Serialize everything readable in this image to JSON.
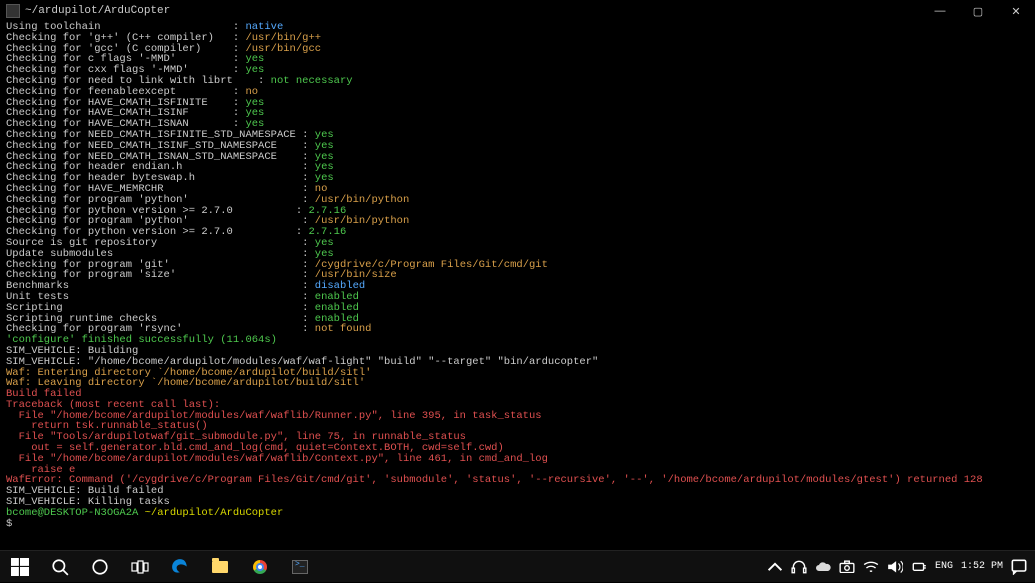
{
  "window": {
    "title": "~/ardupilot/ArduCopter",
    "minimize": "—",
    "maximize": "▢",
    "close": "✕"
  },
  "lines": [
    [
      [
        "w",
        "Using toolchain                     : "
      ],
      [
        "c",
        "native"
      ]
    ],
    [
      [
        "w",
        "Checking for 'g++' (C++ compiler)   : "
      ],
      [
        "g",
        "/usr/bin/g++"
      ]
    ],
    [
      [
        "w",
        "Checking for 'gcc' (C compiler)     : "
      ],
      [
        "g",
        "/usr/bin/gcc"
      ]
    ],
    [
      [
        "w",
        "Checking for c flags '-MMD'         : "
      ],
      [
        "gr",
        "yes"
      ]
    ],
    [
      [
        "w",
        "Checking for cxx flags '-MMD'       : "
      ],
      [
        "gr",
        "yes"
      ]
    ],
    [
      [
        "w",
        "Checking for need to link with librt    : "
      ],
      [
        "gr",
        "not necessary"
      ]
    ],
    [
      [
        "w",
        "Checking for feenableexcept         : "
      ],
      [
        "g",
        "no"
      ]
    ],
    [
      [
        "w",
        "Checking for HAVE_CMATH_ISFINITE    : "
      ],
      [
        "gr",
        "yes"
      ]
    ],
    [
      [
        "w",
        "Checking for HAVE_CMATH_ISINF       : "
      ],
      [
        "gr",
        "yes"
      ]
    ],
    [
      [
        "w",
        "Checking for HAVE_CMATH_ISNAN       : "
      ],
      [
        "gr",
        "yes"
      ]
    ],
    [
      [
        "w",
        "Checking for NEED_CMATH_ISFINITE_STD_NAMESPACE : "
      ],
      [
        "gr",
        "yes"
      ]
    ],
    [
      [
        "w",
        "Checking for NEED_CMATH_ISINF_STD_NAMESPACE    : "
      ],
      [
        "gr",
        "yes"
      ]
    ],
    [
      [
        "w",
        "Checking for NEED_CMATH_ISNAN_STD_NAMESPACE    : "
      ],
      [
        "gr",
        "yes"
      ]
    ],
    [
      [
        "w",
        "Checking for header endian.h                   : "
      ],
      [
        "gr",
        "yes"
      ]
    ],
    [
      [
        "w",
        "Checking for header byteswap.h                 : "
      ],
      [
        "gr",
        "yes"
      ]
    ],
    [
      [
        "w",
        "Checking for HAVE_MEMRCHR                      : "
      ],
      [
        "g",
        "no"
      ]
    ],
    [
      [
        "w",
        "Checking for program 'python'                  : "
      ],
      [
        "g",
        "/usr/bin/python"
      ]
    ],
    [
      [
        "w",
        "Checking for python version >= 2.7.0          : "
      ],
      [
        "gr",
        "2.7.16"
      ]
    ],
    [
      [
        "w",
        "Checking for program 'python'                  : "
      ],
      [
        "g",
        "/usr/bin/python"
      ]
    ],
    [
      [
        "w",
        "Checking for python version >= 2.7.0          : "
      ],
      [
        "gr",
        "2.7.16"
      ]
    ],
    [
      [
        "w",
        "Source is git repository                       : "
      ],
      [
        "gr",
        "yes"
      ]
    ],
    [
      [
        "w",
        "Update submodules                              : "
      ],
      [
        "gr",
        "yes"
      ]
    ],
    [
      [
        "w",
        "Checking for program 'git'                     : "
      ],
      [
        "g",
        "/cygdrive/c/Program Files/Git/cmd/git"
      ]
    ],
    [
      [
        "w",
        "Checking for program 'size'                    : "
      ],
      [
        "g",
        "/usr/bin/size"
      ]
    ],
    [
      [
        "w",
        "Benchmarks                                     : "
      ],
      [
        "c",
        "disabled"
      ]
    ],
    [
      [
        "w",
        "Unit tests                                     : "
      ],
      [
        "gr",
        "enabled"
      ]
    ],
    [
      [
        "w",
        "Scripting                                      : "
      ],
      [
        "gr",
        "enabled"
      ]
    ],
    [
      [
        "w",
        "Scripting runtime checks                       : "
      ],
      [
        "gr",
        "enabled"
      ]
    ],
    [
      [
        "w",
        "Checking for program 'rsync'                   : "
      ],
      [
        "g",
        "not found"
      ]
    ],
    [
      [
        "gr",
        "'configure' finished successfully (11.064s)"
      ]
    ],
    [
      [
        "w",
        "SIM_VEHICLE: Building"
      ]
    ],
    [
      [
        "w",
        "SIM_VEHICLE: \"/home/bcome/ardupilot/modules/waf/waf-light\" \"build\" \"--target\" \"bin/arducopter\""
      ]
    ],
    [
      [
        "g",
        "Waf: Entering directory `/home/bcome/ardupilot/build/sitl'"
      ]
    ],
    [
      [
        "g",
        "Waf: Leaving directory `/home/bcome/ardupilot/build/sitl'"
      ]
    ],
    [
      [
        "r",
        "Build failed"
      ]
    ],
    [
      [
        "r",
        "Traceback (most recent call last):"
      ]
    ],
    [
      [
        "r",
        "  File \"/home/bcome/ardupilot/modules/waf/waflib/Runner.py\", line 395, in task_status"
      ]
    ],
    [
      [
        "r",
        "    return tsk.runnable_status()"
      ]
    ],
    [
      [
        "r",
        "  File \"Tools/ardupilotwaf/git_submodule.py\", line 75, in runnable_status"
      ]
    ],
    [
      [
        "r",
        "    out = self.generator.bld.cmd_and_log(cmd, quiet=Context.BOTH, cwd=self.cwd)"
      ]
    ],
    [
      [
        "r",
        "  File \"/home/bcome/ardupilot/modules/waf/waflib/Context.py\", line 461, in cmd_and_log"
      ]
    ],
    [
      [
        "r",
        "    raise e"
      ]
    ],
    [
      [
        "r",
        "WafError: Command ('/cygdrive/c/Program Files/Git/cmd/git', 'submodule', 'status', '--recursive', '--', '/home/bcome/ardupilot/modules/gtest') returned 128"
      ]
    ],
    [
      [
        "w",
        ""
      ]
    ],
    [
      [
        "w",
        "SIM_VEHICLE: Build failed"
      ]
    ],
    [
      [
        "w",
        "SIM_VEHICLE: Killing tasks"
      ]
    ],
    [
      [
        "w",
        ""
      ]
    ],
    [
      [
        "gr",
        "bcome@DESKTOP-N3OGA2A "
      ],
      [
        "y",
        "~/ardupilot/ArduCopter"
      ]
    ],
    [
      [
        "w",
        "$"
      ]
    ]
  ],
  "colors": {
    "w": "c-white",
    "c": "c-cyan",
    "g": "c-gold",
    "gr": "c-green",
    "r": "c-red",
    "y": "c-yellow"
  },
  "taskbar": {
    "lang": "ENG",
    "time": "1:52 PM",
    "date": "",
    "tray_icons": [
      "up-icon",
      "headset-icon",
      "onedrive-icon",
      "camera-icon",
      "wifi-icon",
      "volume-icon",
      "power-icon"
    ]
  }
}
